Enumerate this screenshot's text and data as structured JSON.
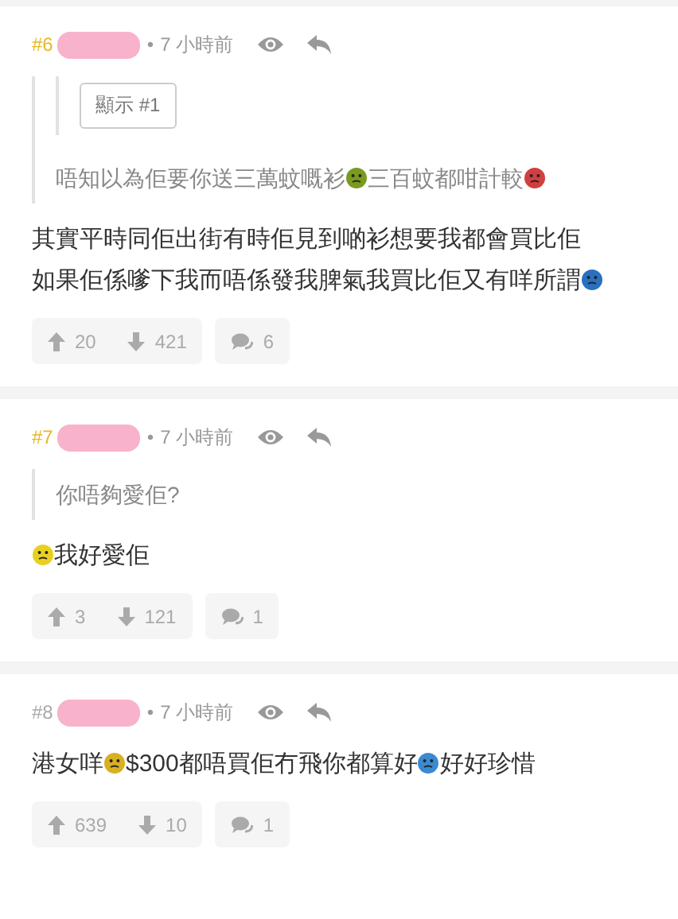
{
  "posts": [
    {
      "number": "#6",
      "color": "#e8b828",
      "separator": "•",
      "time": "7 小時前",
      "quote": {
        "nested": {
          "button": "顯示 #1"
        },
        "segments": [
          {
            "kind": "text",
            "text": "唔知以為佢要你送三萬蚊嘅衫"
          },
          {
            "kind": "emoji",
            "color": "#7a9a20"
          },
          {
            "kind": "text",
            "text": "三百蚊都咁計較"
          },
          {
            "kind": "emoji",
            "color": "#d04040"
          }
        ]
      },
      "lines": [
        [
          {
            "kind": "text",
            "text": "其實平時同佢出街有時佢見到啲衫想要我都會買比佢"
          }
        ],
        [
          {
            "kind": "text",
            "text": "如果佢係嗲下我而唔係發我脾氣我買比佢又有咩所謂"
          },
          {
            "kind": "emoji",
            "color": "#2a70c0"
          }
        ]
      ],
      "upvotes": "20",
      "downvotes": "421",
      "replies": "6"
    },
    {
      "number": "#7",
      "color": "#e8b828",
      "separator": "•",
      "time": "7 小時前",
      "quote": {
        "segments": [
          {
            "kind": "text",
            "text": "你唔夠愛佢?"
          }
        ]
      },
      "lines": [
        [
          {
            "kind": "emoji",
            "color": "#e8d020"
          },
          {
            "kind": "text",
            "text": "我好愛佢"
          }
        ]
      ],
      "upvotes": "3",
      "downvotes": "121",
      "replies": "1"
    },
    {
      "number": "#8",
      "color": "#aaaaaa",
      "separator": "•",
      "time": "7 小時前",
      "lines": [
        [
          {
            "kind": "text",
            "text": "港女咩"
          },
          {
            "kind": "emoji",
            "color": "#d8b020"
          },
          {
            "kind": "text",
            "text": "$300都唔買佢冇飛你都算好"
          },
          {
            "kind": "emoji",
            "color": "#3a8ad0"
          },
          {
            "kind": "text",
            "text": "好好珍惜"
          }
        ]
      ],
      "upvotes": "639",
      "downvotes": "10",
      "replies": "1"
    }
  ]
}
